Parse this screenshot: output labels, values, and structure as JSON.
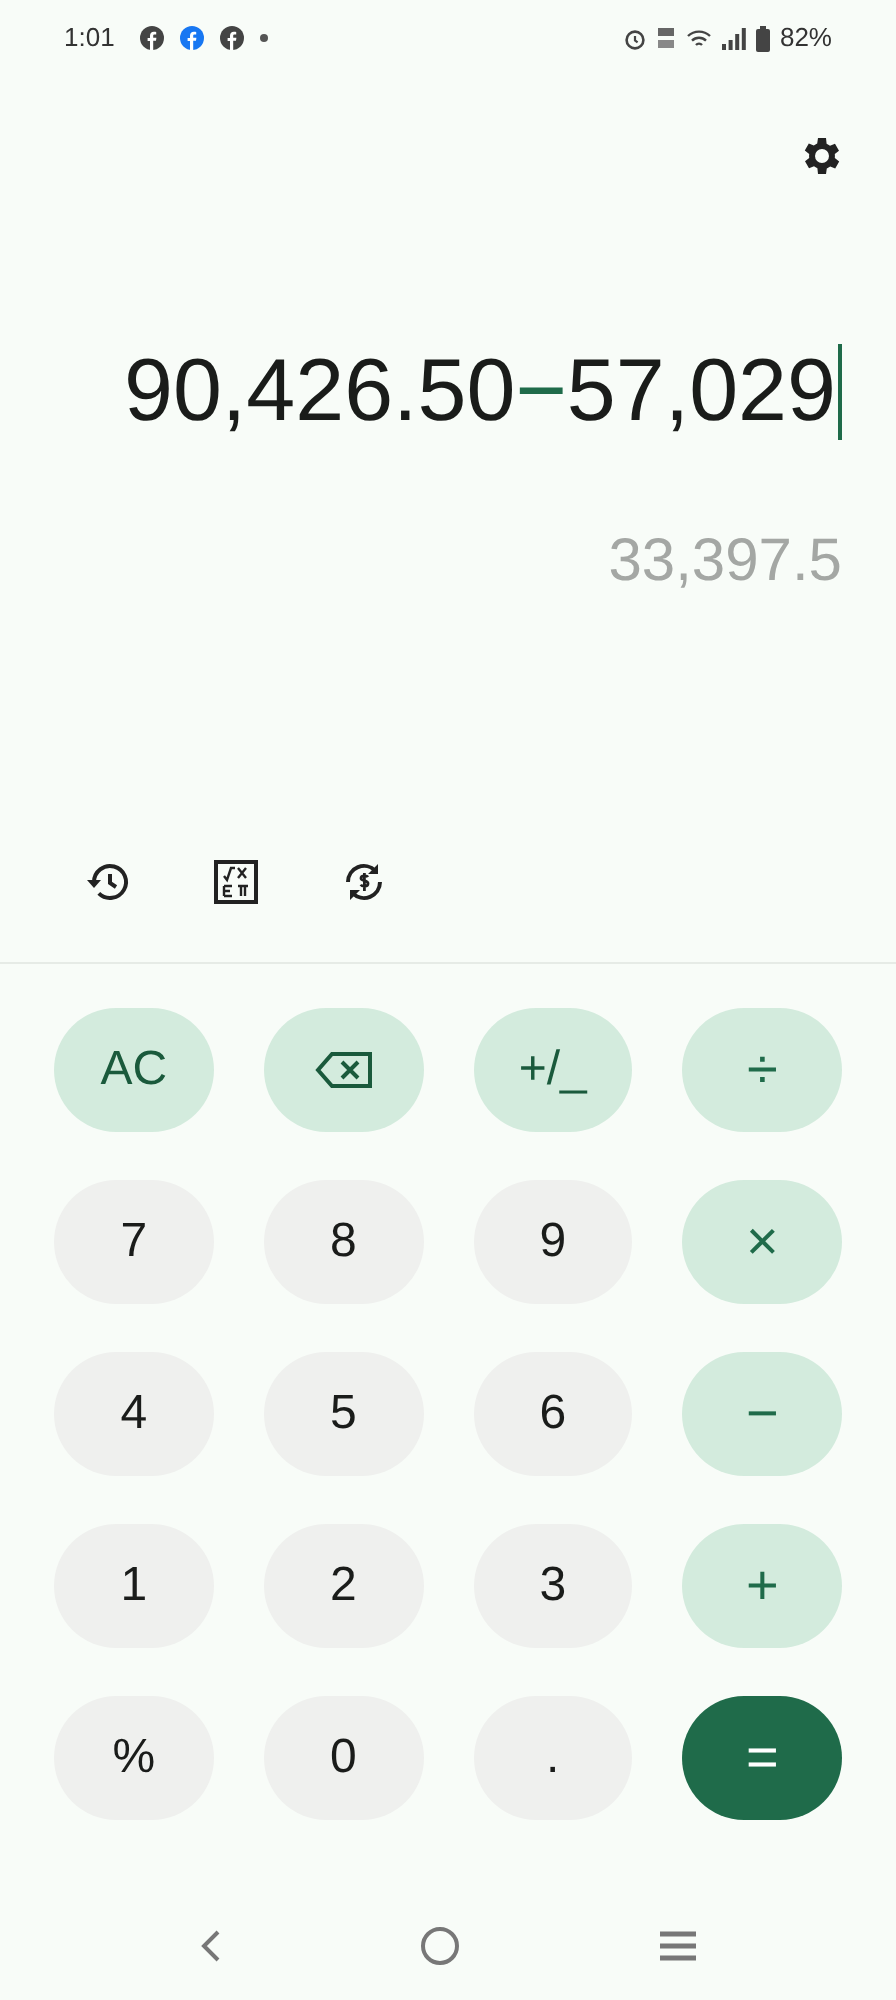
{
  "status_bar": {
    "time": "1:01",
    "battery": "82%"
  },
  "expression": [
    {
      "kind": "number",
      "text": "90,426.50"
    },
    {
      "kind": "operator",
      "text": "−"
    },
    {
      "kind": "number",
      "text": "57,029"
    }
  ],
  "result": "33,397.5",
  "keypad": [
    {
      "kind": "function",
      "label": "AC"
    },
    {
      "kind": "backspace"
    },
    {
      "kind": "function",
      "label": "+/_"
    },
    {
      "kind": "operator",
      "label": "÷"
    },
    {
      "kind": "digit",
      "label": "7"
    },
    {
      "kind": "digit",
      "label": "8"
    },
    {
      "kind": "digit",
      "label": "9"
    },
    {
      "kind": "operator",
      "label": "×"
    },
    {
      "kind": "digit",
      "label": "4"
    },
    {
      "kind": "digit",
      "label": "5"
    },
    {
      "kind": "digit",
      "label": "6"
    },
    {
      "kind": "operator",
      "label": "−"
    },
    {
      "kind": "digit",
      "label": "1"
    },
    {
      "kind": "digit",
      "label": "2"
    },
    {
      "kind": "digit",
      "label": "3"
    },
    {
      "kind": "operator",
      "label": "+"
    },
    {
      "kind": "digit",
      "label": "%"
    },
    {
      "kind": "digit",
      "label": "0"
    },
    {
      "kind": "digit",
      "label": "."
    },
    {
      "kind": "equals",
      "label": "="
    }
  ]
}
